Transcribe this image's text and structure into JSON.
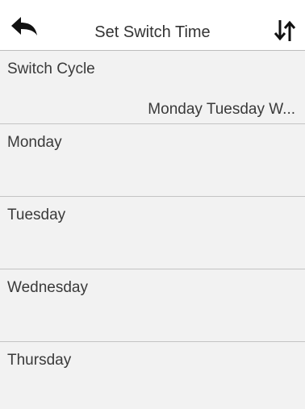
{
  "header": {
    "title": "Set Switch Time",
    "back_icon": "back-arrow-icon",
    "sort_icon": "sort-arrows-icon"
  },
  "rows": [
    {
      "label": "Switch Cycle",
      "value": "Monday Tuesday W..."
    },
    {
      "label": "Monday",
      "value": ""
    },
    {
      "label": "Tuesday",
      "value": ""
    },
    {
      "label": "Wednesday",
      "value": ""
    },
    {
      "label": "Thursday",
      "value": ""
    }
  ],
  "colors": {
    "header_bg": "#ffffff",
    "list_bg": "#f2f2f2",
    "divider": "#c4c4c4",
    "text": "#3a3a3a"
  }
}
